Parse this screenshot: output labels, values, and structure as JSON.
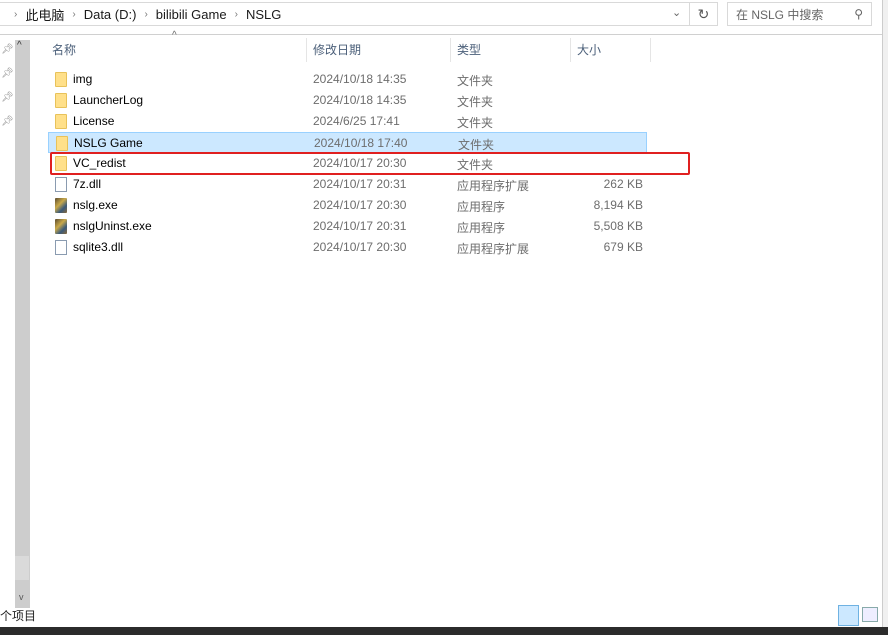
{
  "breadcrumb": [
    "此电脑",
    "Data (D:)",
    "bilibili Game",
    "NSLG"
  ],
  "search": {
    "placeholder": "在 NSLG 中搜索"
  },
  "columns": {
    "name": "名称",
    "date": "修改日期",
    "type": "类型",
    "size": "大小"
  },
  "files": [
    {
      "name": "img",
      "date": "2024/10/18 14:35",
      "type": "文件夹",
      "size": "",
      "icon": "folder"
    },
    {
      "name": "LauncherLog",
      "date": "2024/10/18 14:35",
      "type": "文件夹",
      "size": "",
      "icon": "folder"
    },
    {
      "name": "License",
      "date": "2024/6/25 17:41",
      "type": "文件夹",
      "size": "",
      "icon": "folder"
    },
    {
      "name": "NSLG Game",
      "date": "2024/10/18 17:40",
      "type": "文件夹",
      "size": "",
      "icon": "folder",
      "selected": true
    },
    {
      "name": "VC_redist",
      "date": "2024/10/17 20:30",
      "type": "文件夹",
      "size": "",
      "icon": "folder",
      "highlighted": true
    },
    {
      "name": "7z.dll",
      "date": "2024/10/17 20:31",
      "type": "应用程序扩展",
      "size": "262 KB",
      "icon": "dll"
    },
    {
      "name": "nslg.exe",
      "date": "2024/10/17 20:30",
      "type": "应用程序",
      "size": "8,194 KB",
      "icon": "exe"
    },
    {
      "name": "nslgUninst.exe",
      "date": "2024/10/17 20:31",
      "type": "应用程序",
      "size": "5,508 KB",
      "icon": "exe"
    },
    {
      "name": "sqlite3.dll",
      "date": "2024/10/17 20:30",
      "type": "应用程序扩展",
      "size": "679 KB",
      "icon": "dll"
    }
  ],
  "status": {
    "items_text": "个项目"
  },
  "colors": {
    "selection": "#cce8ff",
    "highlight_box": "#e02020"
  }
}
